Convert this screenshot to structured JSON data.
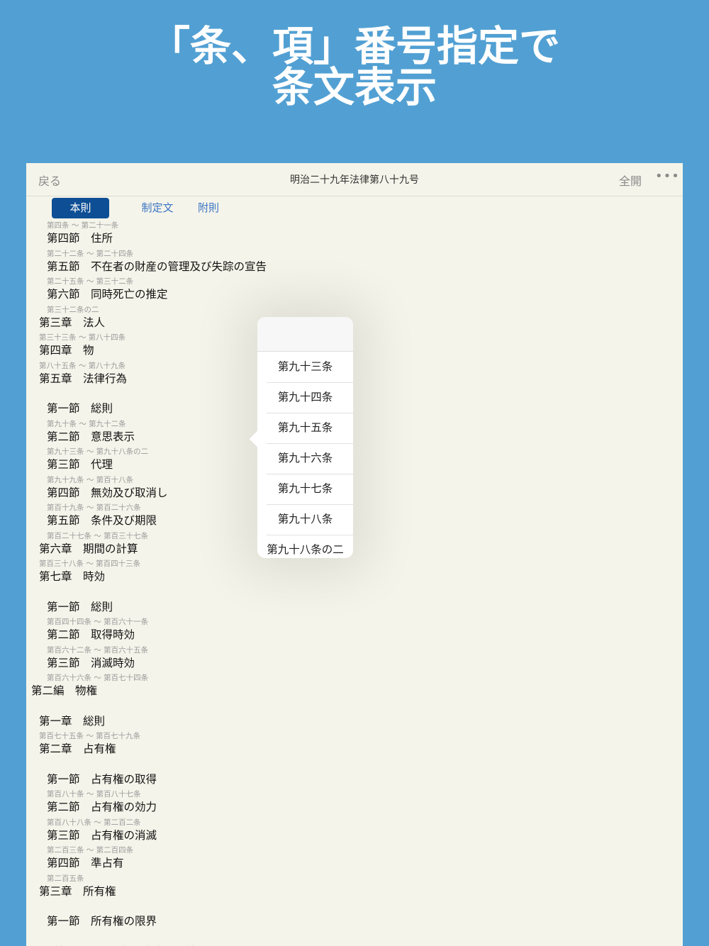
{
  "headline": {
    "line1": "「条、項」番号指定で",
    "line2": "条文表示"
  },
  "nav": {
    "back": "戻る",
    "title": "明治二十九年法律第八十九号",
    "expand": "全開",
    "more": "•••"
  },
  "tabs": [
    "本則",
    "制定文",
    "附則"
  ],
  "toc": [
    {
      "kind": "range",
      "text": "第四条 ～ 第二十一条",
      "level": 2
    },
    {
      "kind": "head",
      "text": "第四節　住所",
      "level": 2
    },
    {
      "kind": "range",
      "text": "第二十二条 ～ 第二十四条",
      "level": 2
    },
    {
      "kind": "head",
      "text": "第五節　不在者の財産の管理及び失踪の宣告",
      "level": 2
    },
    {
      "kind": "range",
      "text": "第二十五条 ～ 第三十二条",
      "level": 2
    },
    {
      "kind": "head",
      "text": "第六節　同時死亡の推定",
      "level": 2
    },
    {
      "kind": "range",
      "text": "第三十二条の二",
      "level": 2
    },
    {
      "kind": "head",
      "text": "第三章　法人",
      "level": 1
    },
    {
      "kind": "range",
      "text": "第三十三条 ～ 第八十四条",
      "level": 1
    },
    {
      "kind": "head",
      "text": "第四章　物",
      "level": 1
    },
    {
      "kind": "range",
      "text": "第八十五条 ～ 第八十九条",
      "level": 1
    },
    {
      "kind": "head",
      "text": "第五章　法律行為",
      "level": 1
    },
    {
      "kind": "gap"
    },
    {
      "kind": "head",
      "text": "第一節　総則",
      "level": 2
    },
    {
      "kind": "range",
      "text": "第九十条 ～ 第九十二条",
      "level": 2
    },
    {
      "kind": "head",
      "text": "第二節　意思表示",
      "level": 2
    },
    {
      "kind": "range",
      "text": "第九十三条 ～ 第九十八条の二",
      "level": 2
    },
    {
      "kind": "head",
      "text": "第三節　代理",
      "level": 2
    },
    {
      "kind": "range",
      "text": "第九十九条 ～ 第百十八条",
      "level": 2
    },
    {
      "kind": "head",
      "text": "第四節　無効及び取消し",
      "level": 2
    },
    {
      "kind": "range",
      "text": "第百十九条 ～ 第百二十六条",
      "level": 2
    },
    {
      "kind": "head",
      "text": "第五節　条件及び期限",
      "level": 2
    },
    {
      "kind": "range",
      "text": "第百二十七条 ～ 第百三十七条",
      "level": 2
    },
    {
      "kind": "head",
      "text": "第六章　期間の計算",
      "level": 1
    },
    {
      "kind": "range",
      "text": "第百三十八条 ～ 第百四十三条",
      "level": 1
    },
    {
      "kind": "head",
      "text": "第七章　時効",
      "level": 1
    },
    {
      "kind": "gap"
    },
    {
      "kind": "head",
      "text": "第一節　総則",
      "level": 2
    },
    {
      "kind": "range",
      "text": "第百四十四条 ～ 第百六十一条",
      "level": 2
    },
    {
      "kind": "head",
      "text": "第二節　取得時効",
      "level": 2
    },
    {
      "kind": "range",
      "text": "第百六十二条 ～ 第百六十五条",
      "level": 2
    },
    {
      "kind": "head",
      "text": "第三節　消滅時効",
      "level": 2
    },
    {
      "kind": "range",
      "text": "第百六十六条 ～ 第百七十四条",
      "level": 2
    },
    {
      "kind": "head",
      "text": "第二編　物権",
      "level": 0
    },
    {
      "kind": "gap"
    },
    {
      "kind": "head",
      "text": "第一章　総則",
      "level": 1
    },
    {
      "kind": "range",
      "text": "第百七十五条 ～ 第百七十九条",
      "level": 1
    },
    {
      "kind": "head",
      "text": "第二章　占有権",
      "level": 1
    },
    {
      "kind": "gap"
    },
    {
      "kind": "head",
      "text": "第一節　占有権の取得",
      "level": 2
    },
    {
      "kind": "range",
      "text": "第百八十条 ～ 第百八十七条",
      "level": 2
    },
    {
      "kind": "head",
      "text": "第二節　占有権の効力",
      "level": 2
    },
    {
      "kind": "range",
      "text": "第百八十八条 ～ 第二百二条",
      "level": 2
    },
    {
      "kind": "head",
      "text": "第三節　占有権の消滅",
      "level": 2
    },
    {
      "kind": "range",
      "text": "第二百三条 ～ 第二百四条",
      "level": 2
    },
    {
      "kind": "head",
      "text": "第四節　準占有",
      "level": 2
    },
    {
      "kind": "range",
      "text": "第二百五条",
      "level": 2
    },
    {
      "kind": "head",
      "text": "第三章　所有権",
      "level": 1
    },
    {
      "kind": "gap"
    },
    {
      "kind": "head",
      "text": "第一節　所有権の限界",
      "level": 2
    },
    {
      "kind": "gap"
    },
    {
      "kind": "head",
      "text": "第一款　所有権の内容及び範囲",
      "level": 3
    }
  ],
  "picker": {
    "options": [
      "第九十三条",
      "第九十四条",
      "第九十五条",
      "第九十六条",
      "第九十七条",
      "第九十八条",
      "第九十八条の二"
    ]
  }
}
